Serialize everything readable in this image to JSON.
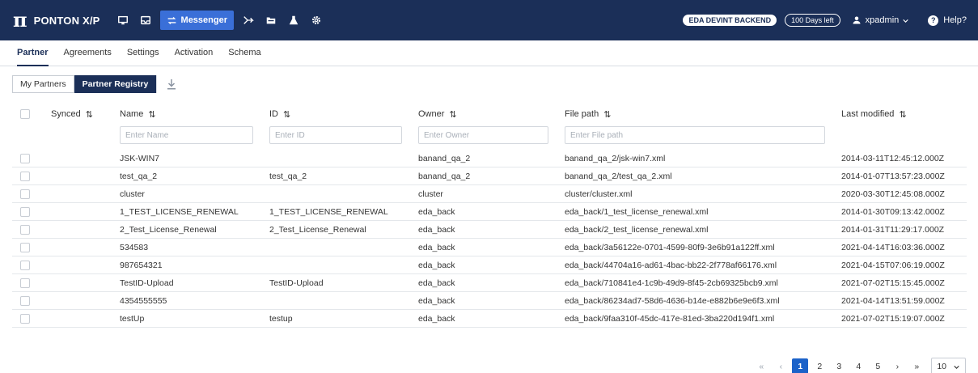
{
  "header": {
    "logo_symbol": "π",
    "app_name": "PONTON X/P",
    "nav_icons": [
      "monitor-icon",
      "inbox-icon",
      "transfer-icon",
      "route-icon",
      "folder-icon",
      "flask-icon",
      "gear-icon"
    ],
    "active_nav_label": "Messenger",
    "environment_badge": "EDA DEVINT BACKEND",
    "days_badge": "100 Days left",
    "user_label": "xpadmin",
    "help_label": "Help?"
  },
  "subnav": {
    "tabs": [
      "Partner",
      "Agreements",
      "Settings",
      "Activation",
      "Schema"
    ],
    "active": "Partner"
  },
  "toggle": {
    "my_partners": "My Partners",
    "partner_registry": "Partner Registry"
  },
  "table": {
    "columns": {
      "synced": "Synced",
      "name": "Name",
      "id": "ID",
      "owner": "Owner",
      "file_path": "File path",
      "last_modified": "Last modified"
    },
    "sort_icon": "⇅",
    "filters": {
      "name": "Enter Name",
      "id": "Enter ID",
      "owner": "Enter Owner",
      "file_path": "Enter File path"
    },
    "rows": [
      {
        "name": "JSK-WIN7",
        "id": "",
        "owner": "banand_qa_2",
        "file_path": "banand_qa_2/jsk-win7.xml",
        "last_modified": "2014-03-11T12:45:12.000Z"
      },
      {
        "name": "test_qa_2",
        "id": "test_qa_2",
        "owner": "banand_qa_2",
        "file_path": "banand_qa_2/test_qa_2.xml",
        "last_modified": "2014-01-07T13:57:23.000Z"
      },
      {
        "name": "cluster",
        "id": "",
        "owner": "cluster",
        "file_path": "cluster/cluster.xml",
        "last_modified": "2020-03-30T12:45:08.000Z"
      },
      {
        "name": "1_TEST_LICENSE_RENEWAL",
        "id": "1_TEST_LICENSE_RENEWAL",
        "owner": "eda_back",
        "file_path": "eda_back/1_test_license_renewal.xml",
        "last_modified": "2014-01-30T09:13:42.000Z"
      },
      {
        "name": "2_Test_License_Renewal",
        "id": "2_Test_License_Renewal",
        "owner": "eda_back",
        "file_path": "eda_back/2_test_license_renewal.xml",
        "last_modified": "2014-01-31T11:29:17.000Z"
      },
      {
        "name": "534583",
        "id": "",
        "owner": "eda_back",
        "file_path": "eda_back/3a56122e-0701-4599-80f9-3e6b91a122ff.xml",
        "last_modified": "2021-04-14T16:03:36.000Z"
      },
      {
        "name": "987654321",
        "id": "",
        "owner": "eda_back",
        "file_path": "eda_back/44704a16-ad61-4bac-bb22-2f778af66176.xml",
        "last_modified": "2021-04-15T07:06:19.000Z"
      },
      {
        "name": "TestID-Upload",
        "id": "TestID-Upload",
        "owner": "eda_back",
        "file_path": "eda_back/710841e4-1c9b-49d9-8f45-2cb69325bcb9.xml",
        "last_modified": "2021-07-02T15:15:45.000Z"
      },
      {
        "name": "4354555555",
        "id": "",
        "owner": "eda_back",
        "file_path": "eda_back/86234ad7-58d6-4636-b14e-e882b6e9e6f3.xml",
        "last_modified": "2021-04-14T13:51:59.000Z"
      },
      {
        "name": "testUp",
        "id": "testup",
        "owner": "eda_back",
        "file_path": "eda_back/9faa310f-45dc-417e-81ed-3ba220d194f1.xml",
        "last_modified": "2021-07-02T15:19:07.000Z"
      }
    ]
  },
  "pagination": {
    "first": "«",
    "prev": "‹",
    "pages": [
      "1",
      "2",
      "3",
      "4",
      "5"
    ],
    "current": "1",
    "next": "›",
    "last": "»",
    "page_size": "10"
  },
  "colors": {
    "header_bg": "#1b2f58",
    "active_nav": "#3a6fd8",
    "current_page": "#1b62c9"
  }
}
